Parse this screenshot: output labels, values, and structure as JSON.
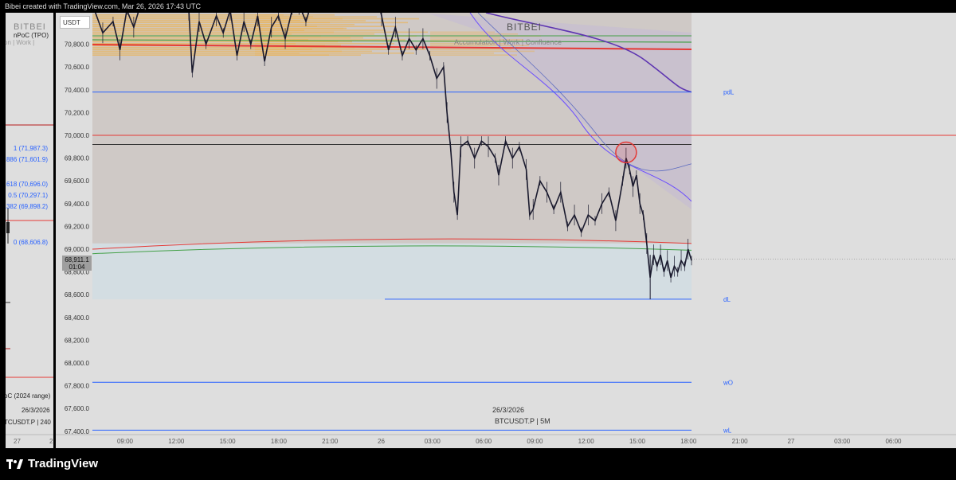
{
  "header": {
    "caption": "Bibei created with TradingView.com, Mar 26, 2026 17:43 UTC"
  },
  "brand": {
    "name": "TradingView"
  },
  "left_pane": {
    "watermark": "BITBEI",
    "session": "on | Work |",
    "vpoc": "nPoC (TPO)",
    "fib_levels": [
      {
        "label": "1 (71,987.3)",
        "value": 71987.3
      },
      {
        "label": ".886 (71,601.9)",
        "value": 71601.9
      },
      {
        "label": ".618 (70,696.0)",
        "value": 70696.0
      },
      {
        "label": "0.5 (70,297.1)",
        "value": 70297.1
      },
      {
        "label": ".382 (69,898.2)",
        "value": 69898.2
      },
      {
        "label": "0 (68,606.8)",
        "value": 68606.8
      }
    ],
    "poc_range": "oC (2024 range)",
    "date": "26/3/2026",
    "symbol": "TCUSDT.P | 240",
    "time_labels": [
      "27",
      "2"
    ]
  },
  "main": {
    "currency": "USDT",
    "watermark": "BITBEI",
    "session": "Accumulation | Work | Confluence",
    "date": "26/3/2026",
    "symbol": "BTCUSDT.P | 5M",
    "last_price": "68,911.1",
    "countdown": "01:04"
  },
  "chart_data": {
    "type": "line",
    "ylim": [
      67300,
      71900
    ],
    "y_ticks": [
      67400,
      67600,
      67800,
      68000,
      68200,
      68400,
      68600,
      68800,
      69000,
      69200,
      69400,
      69600,
      69800,
      70000,
      70200,
      70400,
      70600,
      70800
    ],
    "y_tick_labels": [
      "67,400.0",
      "67,600.0",
      "67,800.0",
      "68,000.0",
      "68,200.0",
      "68,400.0",
      "68,600.0",
      "68,800.0",
      "69,000.0",
      "69,200.0",
      "69,400.0",
      "69,600.0",
      "69,800.0",
      "70,000.0",
      "70,200.0",
      "70,400.0",
      "70,600.0",
      "70,800.0"
    ],
    "x_ticks": [
      "09:00",
      "12:00",
      "15:00",
      "18:00",
      "21:00",
      "26",
      "03:00",
      "06:00",
      "09:00",
      "12:00",
      "15:00",
      "18:00",
      "21:00",
      "27",
      "03:00",
      "06:00"
    ],
    "last_price": 68911.1,
    "levels": [
      {
        "name": "pdL",
        "value": 70380,
        "color": "#2962ff"
      },
      {
        "name": "dL",
        "value": 68560,
        "color": "#2962ff"
      },
      {
        "name": "wO",
        "value": 67830,
        "color": "#2962ff"
      },
      {
        "name": "wL",
        "value": 67410,
        "color": "#2962ff"
      }
    ],
    "price_path": [
      [
        0,
        71150
      ],
      [
        3,
        70900
      ],
      [
        6,
        71000
      ],
      [
        8,
        70750
      ],
      [
        10,
        71100
      ],
      [
        12,
        70950
      ],
      [
        14,
        71150
      ],
      [
        16,
        71250
      ],
      [
        24,
        71300
      ],
      [
        28,
        71100
      ],
      [
        29,
        70550
      ],
      [
        31,
        71000
      ],
      [
        33,
        70800
      ],
      [
        36,
        71050
      ],
      [
        38,
        70900
      ],
      [
        40,
        71100
      ],
      [
        42,
        70700
      ],
      [
        44,
        71000
      ],
      [
        46,
        70800
      ],
      [
        48,
        71050
      ],
      [
        50,
        70650
      ],
      [
        52,
        70950
      ],
      [
        54,
        71050
      ],
      [
        56,
        70850
      ],
      [
        58,
        71100
      ],
      [
        60,
        71150
      ],
      [
        62,
        71000
      ],
      [
        64,
        71200
      ],
      [
        66,
        71150
      ],
      [
        68,
        71300
      ],
      [
        82,
        71300
      ],
      [
        84,
        71050
      ],
      [
        86,
        70750
      ],
      [
        88,
        70950
      ],
      [
        90,
        70700
      ],
      [
        92,
        70850
      ],
      [
        94,
        70750
      ],
      [
        96,
        70850
      ],
      [
        98,
        70700
      ],
      [
        100,
        70500
      ],
      [
        102,
        70600
      ],
      [
        103,
        70200
      ],
      [
        104,
        69900
      ],
      [
        105,
        69500
      ],
      [
        106,
        69300
      ],
      [
        107,
        69900
      ],
      [
        109,
        69950
      ],
      [
        111,
        69800
      ],
      [
        113,
        69950
      ],
      [
        115,
        69900
      ],
      [
        117,
        69800
      ],
      [
        118,
        69650
      ],
      [
        120,
        69950
      ],
      [
        122,
        69800
      ],
      [
        124,
        69900
      ],
      [
        126,
        69700
      ],
      [
        127,
        69300
      ],
      [
        128,
        69350
      ],
      [
        130,
        69600
      ],
      [
        132,
        69500
      ],
      [
        134,
        69350
      ],
      [
        136,
        69500
      ],
      [
        138,
        69200
      ],
      [
        140,
        69300
      ],
      [
        142,
        69150
      ],
      [
        144,
        69300
      ],
      [
        146,
        69250
      ],
      [
        148,
        69400
      ],
      [
        150,
        69500
      ],
      [
        152,
        69250
      ],
      [
        154,
        69600
      ],
      [
        155,
        69800
      ],
      [
        156,
        69700
      ],
      [
        157,
        69550
      ],
      [
        158,
        69650
      ],
      [
        159,
        69400
      ],
      [
        160,
        69300
      ],
      [
        161,
        69050
      ],
      [
        162,
        68750
      ],
      [
        163,
        68950
      ],
      [
        164,
        68850
      ],
      [
        165,
        68950
      ],
      [
        166,
        68800
      ],
      [
        167,
        68900
      ],
      [
        168,
        68750
      ],
      [
        169,
        68850
      ],
      [
        170,
        68800
      ],
      [
        171,
        68900
      ],
      [
        172,
        68850
      ],
      [
        173,
        69000
      ],
      [
        174,
        68900
      ]
    ],
    "annotations": [
      {
        "type": "circle",
        "x": 155,
        "y": 69850,
        "color": "#e53935"
      }
    ]
  }
}
